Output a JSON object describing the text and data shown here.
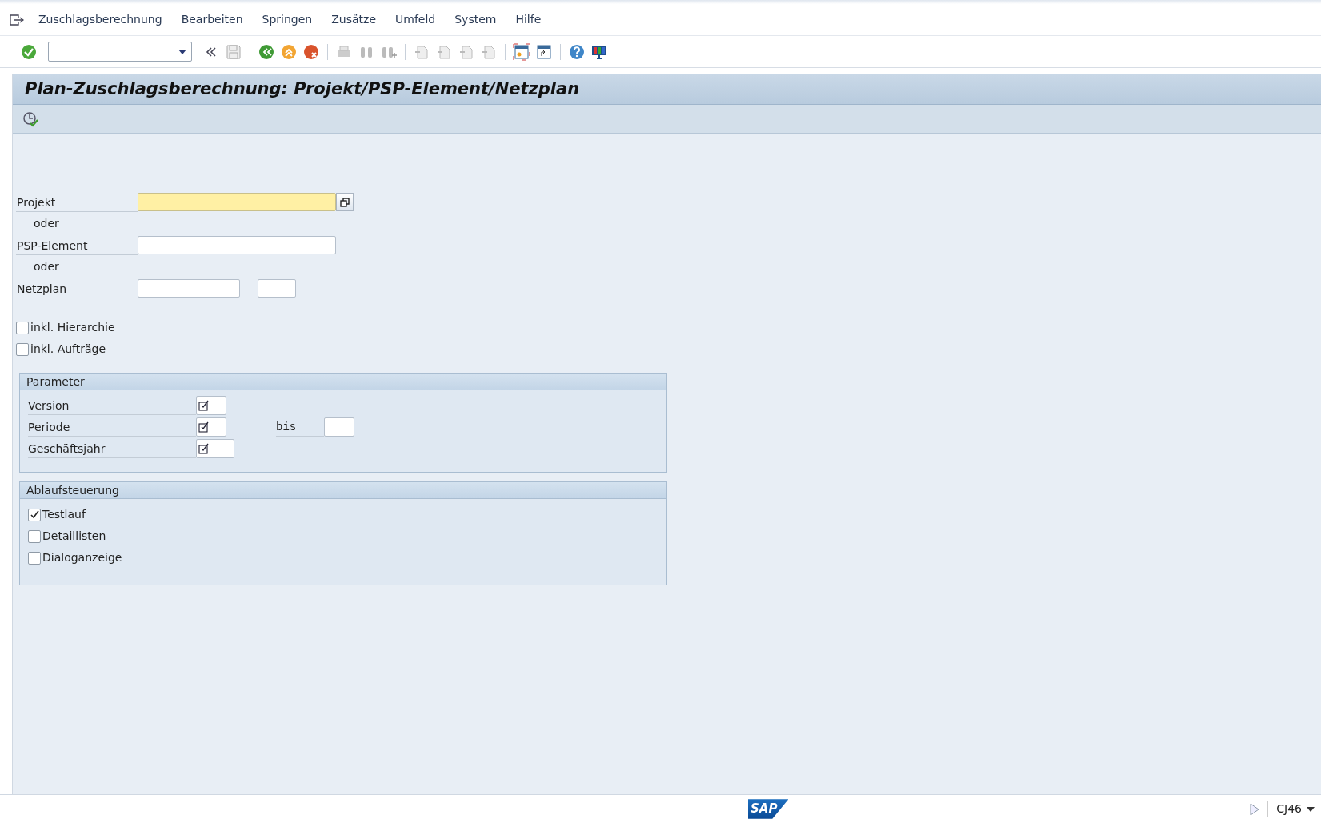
{
  "menu": [
    {
      "label": "Zuschlagsberechnung"
    },
    {
      "label": "Bearbeiten"
    },
    {
      "label": "Springen"
    },
    {
      "label": "Zusätze"
    },
    {
      "label": "Umfeld"
    },
    {
      "label": "System"
    },
    {
      "label": "Hilfe"
    }
  ],
  "title": "Plan-Zuschlagsberechnung: Projekt/PSP-Element/Netzplan",
  "form": [
    {
      "kind": "field",
      "label": "Projekt",
      "focused": true,
      "value_help": true
    },
    {
      "kind": "note",
      "label": "oder"
    },
    {
      "kind": "field",
      "label": "PSP-Element",
      "focused": false,
      "value_help": false
    },
    {
      "kind": "note",
      "label": "oder"
    },
    {
      "kind": "field",
      "label": "Netzplan",
      "focused": false,
      "value_help": false,
      "second_field": true
    }
  ],
  "options": [
    {
      "label": "inkl. Hierarchie",
      "checked": false
    },
    {
      "label": "inkl. Aufträge",
      "checked": false
    }
  ],
  "parameter_group": {
    "title": "Parameter",
    "rows": [
      {
        "label": "Version",
        "required": true
      },
      {
        "label": "Periode",
        "required": true,
        "range_label": "bis"
      },
      {
        "label": "Geschäftsjahr",
        "required": true
      }
    ]
  },
  "control_group": {
    "title": "Ablaufsteuerung",
    "items": [
      {
        "label": "Testlauf",
        "checked": true
      },
      {
        "label": "Detaillisten",
        "checked": false
      },
      {
        "label": "Dialoganzeige",
        "checked": false
      }
    ]
  },
  "status_bar": {
    "logo": "SAP",
    "transaction": "CJ46"
  }
}
